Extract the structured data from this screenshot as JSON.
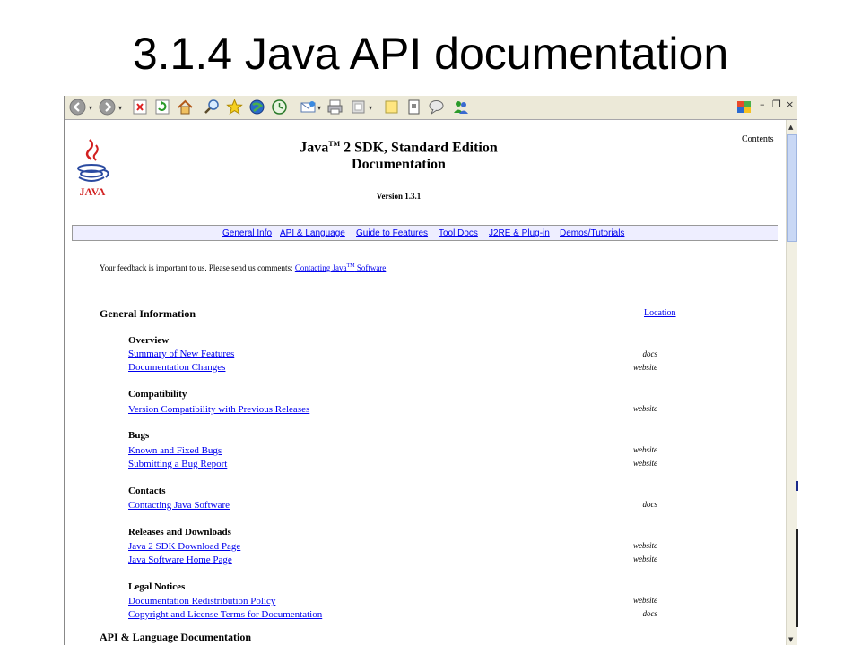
{
  "slide_title": "3.1.4 Java API documentation",
  "doc": {
    "title_line1_a": "Java",
    "title_tm": "TM",
    "title_line1_b": " 2 SDK, Standard Edition",
    "title_line2": "Documentation",
    "version": "Version 1.3.1",
    "contents": "Contents",
    "logo_text": "JAVA"
  },
  "navbar": [
    "General Info",
    "API & Language",
    "Guide to Features",
    "Tool Docs",
    "J2RE & Plug-in",
    "Demos/Tutorials"
  ],
  "feedback": {
    "text": "Your feedback is important to us. Please send us comments: ",
    "link_a": "Contacting Java",
    "link_tm": "TM",
    "link_b": " Software",
    "end": "."
  },
  "general_info": {
    "heading": "General Information",
    "location": "Location"
  },
  "sections": [
    {
      "title": "Overview",
      "links": [
        {
          "label": "Summary of New Features",
          "tag": "docs"
        },
        {
          "label": "Documentation Changes",
          "tag": "website"
        }
      ]
    },
    {
      "title": "Compatibility",
      "links": [
        {
          "label": "Version Compatibility with Previous Releases",
          "tag": "website"
        }
      ]
    },
    {
      "title": "Bugs",
      "links": [
        {
          "label": "Known and Fixed Bugs",
          "tag": "website"
        },
        {
          "label": "Submitting a Bug Report",
          "tag": "website"
        }
      ]
    },
    {
      "title": "Contacts",
      "links": [
        {
          "label": "Contacting Java Software",
          "tag": "docs"
        }
      ]
    },
    {
      "title": "Releases and Downloads",
      "links": [
        {
          "label": "Java 2 SDK Download Page",
          "tag": "website"
        },
        {
          "label": "Java Software Home Page",
          "tag": "website"
        }
      ]
    },
    {
      "title": "Legal Notices",
      "links": [
        {
          "label": "Documentation Redistribution Policy",
          "tag": "website"
        },
        {
          "label": "Copyright and License Terms for Documentation",
          "tag": "docs"
        }
      ]
    }
  ],
  "api_heading": "API & Language Documentation",
  "toolbar_icons": [
    "back-icon",
    "forward-icon",
    "stop-icon",
    "refresh-icon",
    "home-icon",
    "search-icon",
    "favorites-icon",
    "media-icon",
    "history-icon",
    "mail-icon",
    "print-icon",
    "edit-icon",
    "notes-icon",
    "research-icon",
    "messenger-icon",
    "users-icon"
  ],
  "window_controls": {
    "minimize": "–",
    "restore": "❐",
    "close": "×"
  },
  "colors": {
    "link": "#0000ee",
    "navbar_bg": "#eeeeff",
    "toolbar_bg": "#ece9d8"
  }
}
